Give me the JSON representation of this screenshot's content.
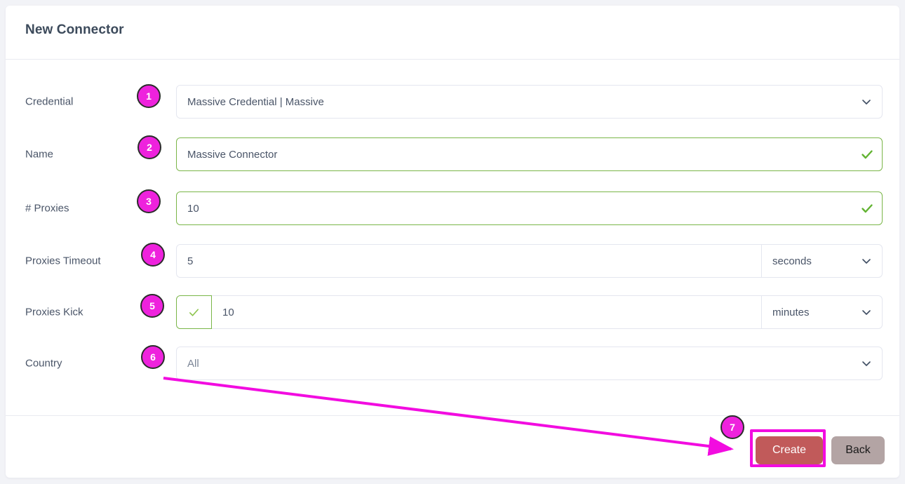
{
  "page": {
    "background_color": "#f2f3f7",
    "card_background": "#ffffff"
  },
  "header": {
    "title": "New Connector"
  },
  "form": {
    "rows": [
      {
        "label": "Credential",
        "control": "select",
        "value": "Massive Credential | Massive",
        "valid": false,
        "badge": "1"
      },
      {
        "label": "Name",
        "control": "text",
        "value": "Massive Connector",
        "valid": true,
        "badge": "2"
      },
      {
        "label": "# Proxies",
        "control": "text",
        "value": "10",
        "valid": true,
        "badge": "3"
      },
      {
        "label": "Proxies Timeout",
        "control": "text-with-unit",
        "value": "5",
        "unit": "seconds",
        "valid": false,
        "badge": "4"
      },
      {
        "label": "Proxies Kick",
        "control": "checkbox-text-with-unit",
        "checked": true,
        "value": "10",
        "unit": "minutes",
        "valid": false,
        "badge": "5"
      },
      {
        "label": "Country",
        "control": "select",
        "value": "All",
        "valid": false,
        "badge": "6"
      }
    ]
  },
  "footer": {
    "create_label": "Create",
    "back_label": "Back",
    "create_color": "#c15a5a",
    "back_color": "#b3a4a4",
    "badge": "7"
  },
  "annotations": {
    "accent_color": "#ee22dd",
    "highlight_color": "#f20ce0",
    "valid_color": "#7ab648"
  }
}
